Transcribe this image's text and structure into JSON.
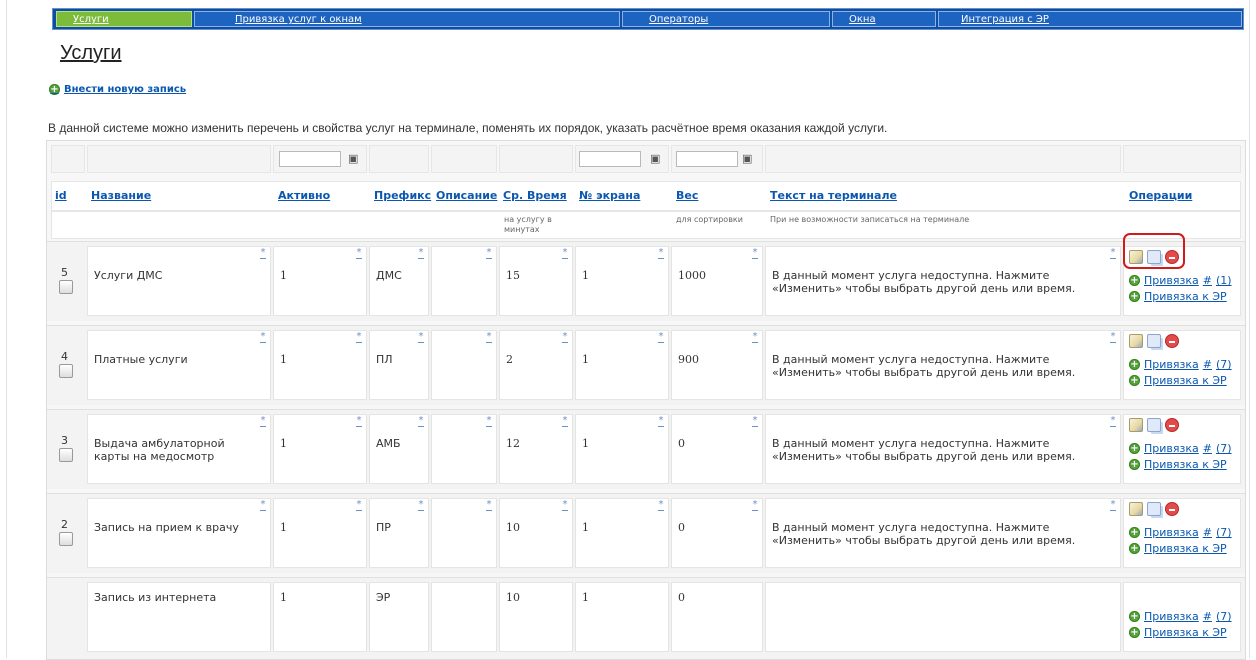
{
  "nav": {
    "tabs": [
      {
        "label": "Услуги",
        "active": true
      },
      {
        "label": "Привязка услуг к окнам",
        "active": false
      },
      {
        "label": "Операторы",
        "active": false
      },
      {
        "label": "Окна",
        "active": false
      },
      {
        "label": "Интеграция с ЭР",
        "active": false
      }
    ]
  },
  "page": {
    "title": "Услуги",
    "add_link": "Внести новую запись",
    "description": "В данной системе можно изменить перечень и свойства услуг на терминале, поменять их порядок, указать расчётное время оказания каждой услуги."
  },
  "table": {
    "headers": {
      "id": "id",
      "name": "Название",
      "active": "Активно",
      "prefix": "Префикс",
      "description": "Описание",
      "avg_time": "Ср. Время",
      "screen": "№ экрана",
      "weight": "Вес",
      "terminal_text": "Текст на терминале",
      "operations": "Операции"
    },
    "subheaders": {
      "avg_time": "на услугу в минутах",
      "weight": "для сортировки",
      "terminal_text": "При не возможности записаться на терминале"
    },
    "rows": [
      {
        "id": "5",
        "name": "Услуги ДМС",
        "active": "1",
        "prefix": "ДМС",
        "description": "",
        "avg_time": "15",
        "screen": "1",
        "weight": "1000",
        "terminal_text": "В данный момент услуга недоступна. Нажмите «Изменить» чтобы выбрать другой день или время.",
        "bind_label": "Привязка",
        "bind_hash": "#",
        "bind_count": "(1)",
        "er_label": "Привязка к ЭР"
      },
      {
        "id": "4",
        "name": "Платные услуги",
        "active": "1",
        "prefix": "ПЛ",
        "description": "",
        "avg_time": "2",
        "screen": "1",
        "weight": "900",
        "terminal_text": "В данный момент услуга недоступна. Нажмите «Изменить» чтобы выбрать другой день или время.",
        "bind_label": "Привязка",
        "bind_hash": "#",
        "bind_count": "(7)",
        "er_label": "Привязка к ЭР"
      },
      {
        "id": "3",
        "name": "Выдача амбулаторной карты на медосмотр",
        "active": "1",
        "prefix": "АМБ",
        "description": "",
        "avg_time": "12",
        "screen": "1",
        "weight": "0",
        "terminal_text": "В данный момент услуга недоступна. Нажмите «Изменить» чтобы выбрать другой день или время.",
        "bind_label": "Привязка",
        "bind_hash": "#",
        "bind_count": "(7)",
        "er_label": "Привязка к ЭР"
      },
      {
        "id": "2",
        "name": "Запись на прием к врачу",
        "active": "1",
        "prefix": "ПР",
        "description": "",
        "avg_time": "10",
        "screen": "1",
        "weight": "0",
        "terminal_text": "В данный момент услуга недоступна. Нажмите «Изменить» чтобы выбрать другой день или время.",
        "bind_label": "Привязка",
        "bind_hash": "#",
        "bind_count": "(7)",
        "er_label": "Привязка к ЭР"
      },
      {
        "id": "",
        "name": "Запись из интернета",
        "active": "1",
        "prefix": "ЭР",
        "description": "",
        "avg_time": "10",
        "screen": "1",
        "weight": "0",
        "terminal_text": "",
        "bind_label": "Привязка",
        "bind_hash": "#",
        "bind_count": "(7)",
        "er_label": "Привязка к ЭР"
      }
    ]
  },
  "colors": {
    "nav_bg": "#0b4ea5",
    "nav_active": "#7dbb3a",
    "link": "#0b57b0",
    "highlight": "#d01b1b"
  },
  "icons": [
    "plus-circle-icon",
    "binoculars-icon",
    "edit-icon",
    "copy-icon",
    "delete-icon",
    "asterisk-icon"
  ]
}
